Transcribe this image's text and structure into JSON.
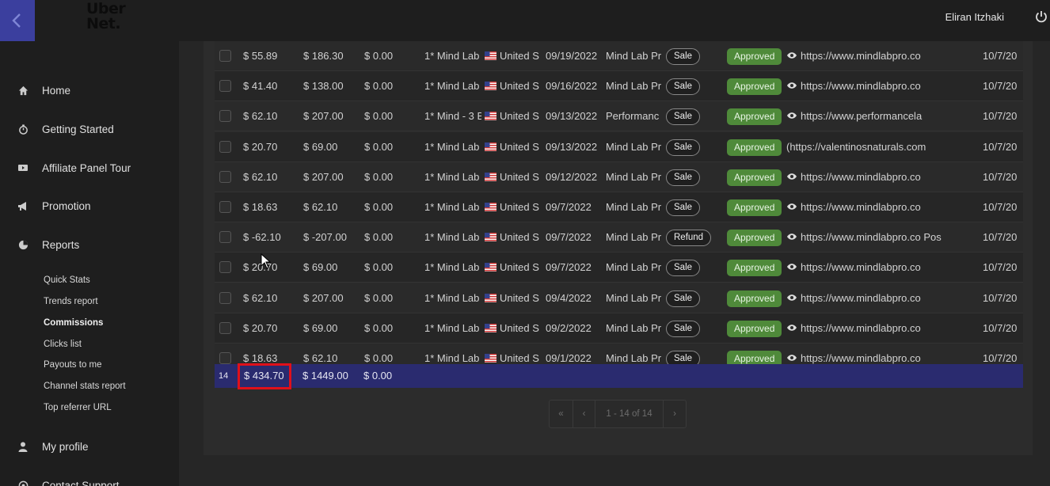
{
  "header": {
    "logo_line1": "Uber",
    "logo_line2": "Net.",
    "username": "Eliran Itzhaki"
  },
  "sidebar": {
    "items": [
      {
        "label": "Home",
        "icon": "home-icon"
      },
      {
        "label": "Getting Started",
        "icon": "stopwatch-icon"
      },
      {
        "label": "Affiliate Panel Tour",
        "icon": "video-icon"
      },
      {
        "label": "Promotion",
        "icon": "bullhorn-icon"
      },
      {
        "label": "Reports",
        "icon": "pie-chart-icon"
      }
    ],
    "report_links": [
      "Quick Stats",
      "Trends report",
      "Commissions",
      "Clicks list",
      "Payouts to me",
      "Channel stats report",
      "Top referrer URL"
    ],
    "active_report": "Commissions",
    "bottom_items": [
      {
        "label": "My profile",
        "icon": "user-icon"
      },
      {
        "label": "Contact Support",
        "icon": "support-icon"
      }
    ]
  },
  "table": {
    "rows": [
      {
        "commission": "$ 55.89",
        "amount": "$ 186.30",
        "extra": "$ 0.00",
        "product": "1* Mind Lab",
        "country": "United S",
        "date": "09/19/2022",
        "offer": "Mind Lab Pr",
        "type": "Sale",
        "status": "Approved",
        "url": "https://www.mindlabpro.co",
        "has_eye": true,
        "created": "10/7/20"
      },
      {
        "commission": "$ 41.40",
        "amount": "$ 138.00",
        "extra": "$ 0.00",
        "product": "1* Mind Lab",
        "country": "United S",
        "date": "09/16/2022",
        "offer": "Mind Lab Pr",
        "type": "Sale",
        "status": "Approved",
        "url": "https://www.mindlabpro.co",
        "has_eye": true,
        "created": "10/7/20"
      },
      {
        "commission": "$ 62.10",
        "amount": "$ 207.00",
        "extra": "$ 0.00",
        "product": "1* Mind - 3 B",
        "country": "United S",
        "date": "09/13/2022",
        "offer": "Performanc",
        "type": "Sale",
        "status": "Approved",
        "url": "https://www.performancela",
        "has_eye": true,
        "created": "10/7/20"
      },
      {
        "commission": "$ 20.70",
        "amount": "$ 69.00",
        "extra": "$ 0.00",
        "product": "1* Mind Lab",
        "country": "United S",
        "date": "09/13/2022",
        "offer": "Mind Lab Pr",
        "type": "Sale",
        "status": "Approved",
        "url": "(https://valentinosnaturals.com",
        "has_eye": false,
        "created": "10/7/20"
      },
      {
        "commission": "$ 62.10",
        "amount": "$ 207.00",
        "extra": "$ 0.00",
        "product": "1* Mind Lab",
        "country": "United S",
        "date": "09/12/2022",
        "offer": "Mind Lab Pr",
        "type": "Sale",
        "status": "Approved",
        "url": "https://www.mindlabpro.co",
        "has_eye": true,
        "created": "10/7/20"
      },
      {
        "commission": "$ 18.63",
        "amount": "$ 62.10",
        "extra": "$ 0.00",
        "product": "1* Mind Lab",
        "country": "United S",
        "date": "09/7/2022",
        "offer": "Mind Lab Pr",
        "type": "Sale",
        "status": "Approved",
        "url": "https://www.mindlabpro.co",
        "has_eye": true,
        "created": "10/7/20"
      },
      {
        "commission": "$ -62.10",
        "amount": "$ -207.00",
        "extra": "$ 0.00",
        "product": "1* Mind Lab",
        "country": "United S",
        "date": "09/7/2022",
        "offer": "Mind Lab Pr",
        "type": "Refund",
        "status": "Approved",
        "url": "https://www.mindlabpro.co Pos",
        "has_eye": true,
        "created": "10/7/20"
      },
      {
        "commission": "$ 20.70",
        "amount": "$ 69.00",
        "extra": "$ 0.00",
        "product": "1* Mind Lab",
        "country": "United S",
        "date": "09/7/2022",
        "offer": "Mind Lab Pr",
        "type": "Sale",
        "status": "Approved",
        "url": "https://www.mindlabpro.co",
        "has_eye": true,
        "created": "10/7/20"
      },
      {
        "commission": "$ 62.10",
        "amount": "$ 207.00",
        "extra": "$ 0.00",
        "product": "1* Mind Lab",
        "country": "United S",
        "date": "09/4/2022",
        "offer": "Mind Lab Pr",
        "type": "Sale",
        "status": "Approved",
        "url": "https://www.mindlabpro.co",
        "has_eye": true,
        "created": "10/7/20"
      },
      {
        "commission": "$ 20.70",
        "amount": "$ 69.00",
        "extra": "$ 0.00",
        "product": "1* Mind Lab",
        "country": "United S",
        "date": "09/2/2022",
        "offer": "Mind Lab Pr",
        "type": "Sale",
        "status": "Approved",
        "url": "https://www.mindlabpro.co",
        "has_eye": true,
        "created": "10/7/20"
      },
      {
        "commission": "$ 18.63",
        "amount": "$ 62.10",
        "extra": "$ 0.00",
        "product": "1* Mind Lab",
        "country": "United S",
        "date": "09/1/2022",
        "offer": "Mind Lab Pr",
        "type": "Sale",
        "status": "Approved",
        "url": "https://www.mindlabpro.co",
        "has_eye": true,
        "created": "10/7/20"
      }
    ],
    "totals": {
      "count": "14",
      "commission": "$ 434.70",
      "amount": "$ 1449.00",
      "extra": "$ 0.00"
    }
  },
  "pagination": {
    "first": "«",
    "prev": "‹",
    "range": "1 - 14 of 14",
    "next": "›"
  },
  "colors": {
    "accent": "#3b3f9e",
    "total_row": "#2a2b6f",
    "approved": "#4f8a3a",
    "highlight": "#e0101a"
  }
}
